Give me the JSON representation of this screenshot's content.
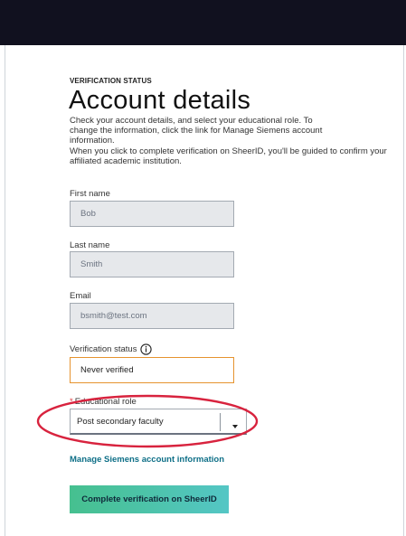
{
  "header": {
    "bar_color": "#11111f"
  },
  "section": {
    "overline": "VERIFICATION STATUS",
    "title": "Account details",
    "description_1": "Check your account details, and select your educational role. To change the information, click the link for Manage Siemens account information.",
    "description_2": "When you click to complete verification on SheerID, you'll be guided to confirm your affiliated academic institution."
  },
  "form": {
    "first_name": {
      "label": "First name",
      "value": "Bob"
    },
    "last_name": {
      "label": "Last name",
      "value": "Smith"
    },
    "email": {
      "label": "Email",
      "value": "bsmith@test.com"
    },
    "verification_status": {
      "label": "Verification status",
      "value": "Never verified",
      "info_icon": "info-icon"
    },
    "educational_role": {
      "required_marker": "*",
      "label": "Educational role",
      "selected": "Post secondary faculty"
    }
  },
  "links": {
    "manage_account": "Manage Siemens account information"
  },
  "actions": {
    "complete_verification": "Complete verification on SheerID"
  },
  "colors": {
    "link": "#0e6f87",
    "status_border": "#e6932f",
    "highlight": "#d8233e",
    "button_gradient_start": "#46c08f",
    "button_gradient_end": "#54c6c5"
  }
}
